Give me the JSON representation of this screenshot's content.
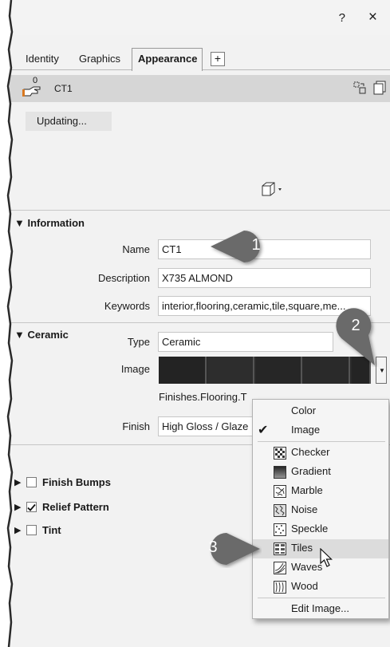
{
  "window": {
    "help_label": "?",
    "close_label": "×"
  },
  "tabs": [
    {
      "label": "Identity"
    },
    {
      "label": "Graphics"
    },
    {
      "label": "Appearance"
    }
  ],
  "tab_add_label": "+",
  "asset": {
    "count": "0",
    "name": "CT1"
  },
  "preview": {
    "status_button": "Updating..."
  },
  "information": {
    "header": "Information",
    "name_label": "Name",
    "name_value": "CT1",
    "description_label": "Description",
    "description_value": "X735 ALMOND",
    "keywords_label": "Keywords",
    "keywords_value": "interior,flooring,ceramic,tile,square,me..."
  },
  "ceramic": {
    "header": "Ceramic",
    "type_label": "Type",
    "type_value": "Ceramic",
    "image_label": "Image",
    "image_filename": "Finishes.Flooring.T",
    "finish_label": "Finish",
    "finish_value": "High Gloss / Glaze"
  },
  "sections": [
    {
      "label": "Finish Bumps",
      "checked": false
    },
    {
      "label": "Relief Pattern",
      "checked": true
    },
    {
      "label": "Tint",
      "checked": false
    }
  ],
  "image_menu": {
    "items": [
      {
        "label": "Color",
        "checked": false,
        "icon": "none"
      },
      {
        "label": "Image",
        "checked": true,
        "icon": "none"
      },
      {
        "label": "Checker",
        "icon": "checker-icon"
      },
      {
        "label": "Gradient",
        "icon": "gradient-icon"
      },
      {
        "label": "Marble",
        "icon": "marble-icon"
      },
      {
        "label": "Noise",
        "icon": "noise-icon"
      },
      {
        "label": "Speckle",
        "icon": "speckle-icon"
      },
      {
        "label": "Tiles",
        "icon": "tiles-icon",
        "highlighted": true
      },
      {
        "label": "Waves",
        "icon": "waves-icon"
      },
      {
        "label": "Wood",
        "icon": "wood-icon"
      }
    ],
    "edit_label": "Edit Image..."
  },
  "callouts": [
    "1",
    "2",
    "3"
  ],
  "colors": {
    "callout": "#6b6b6b",
    "panel": "#f2f2f2",
    "asset_bar": "#d6d6d6",
    "menu_highlight": "#dcdcdc"
  }
}
